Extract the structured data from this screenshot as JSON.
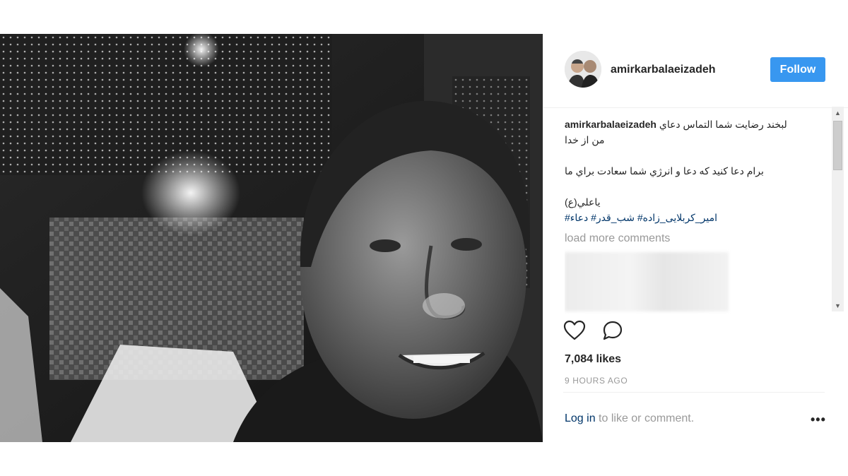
{
  "post": {
    "username": "amirkarbalaeizadeh",
    "follow_label": "Follow",
    "caption": {
      "user": "amirkarbalaeizadeh",
      "line1": "لبخند رضايت شما التماس دعاي",
      "line2": "من از خدا",
      "line3": "برام دعا كنيد كه دعا و انرژي شما سعادت براي ما",
      "line4": "ياعلي(ع)",
      "hashtags": "امیر_کربلایی_زاده# شب_قدر# دعاء#"
    },
    "load_more": "load more comments",
    "likes": "7,084 likes",
    "timestamp": "9 HOURS AGO",
    "login_link": "Log in",
    "login_rest": " to like or comment.",
    "more_label": "•••"
  },
  "icons": {
    "like": "heart-icon",
    "comment": "comment-bubble-icon",
    "more": "more-options-icon"
  },
  "colors": {
    "follow_button": "#3897f0",
    "hashtag": "#003569",
    "muted": "#999999"
  }
}
